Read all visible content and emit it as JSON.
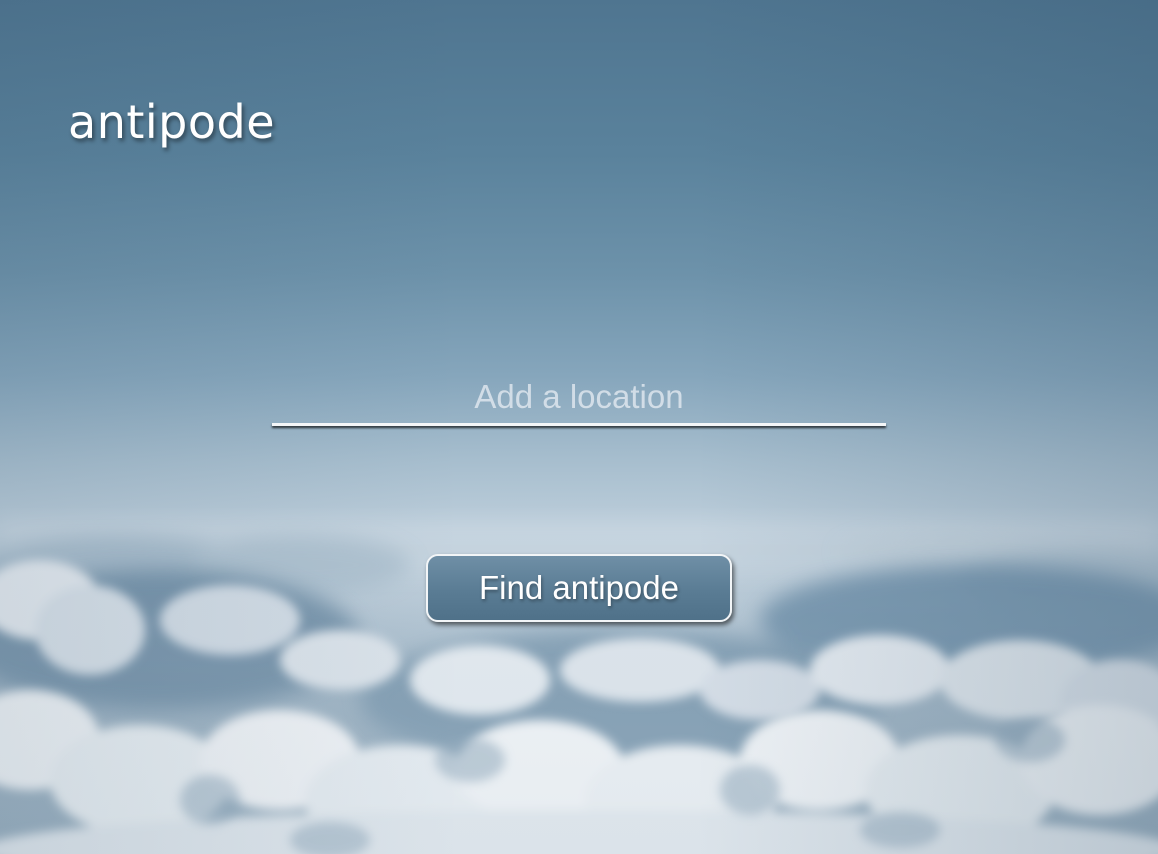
{
  "app": {
    "title": "antipode"
  },
  "search": {
    "value": "",
    "placeholder": "Add a location"
  },
  "actions": {
    "find_label": "Find antipode"
  },
  "colors": {
    "sky_top": "#4f7590",
    "sky_horizon": "#bdcedb",
    "button_fill": "#5a7c94",
    "text": "#ffffff"
  }
}
